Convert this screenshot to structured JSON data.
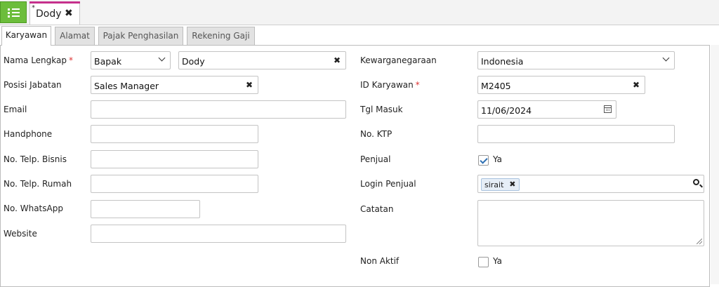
{
  "doc_tab": {
    "modified_marker": "*",
    "title": "Dody",
    "close": "✖"
  },
  "tabs": [
    {
      "label": "Karyawan"
    },
    {
      "label": "Alamat"
    },
    {
      "label": "Pajak Penghasilan"
    },
    {
      "label": "Rekening Gaji"
    }
  ],
  "required_marker": "*",
  "clear_glyph": "✖",
  "form_left": {
    "nama_lengkap": {
      "label": "Nama Lengkap",
      "title_value": "Bapak",
      "name_value": "Dody"
    },
    "posisi_jabatan": {
      "label": "Posisi Jabatan",
      "value": "Sales Manager"
    },
    "email": {
      "label": "Email",
      "value": ""
    },
    "handphone": {
      "label": "Handphone",
      "value": ""
    },
    "telp_bisnis": {
      "label": "No. Telp. Bisnis",
      "value": ""
    },
    "telp_rumah": {
      "label": "No. Telp. Rumah",
      "value": ""
    },
    "whatsapp": {
      "label": "No. WhatsApp",
      "value": ""
    },
    "website": {
      "label": "Website",
      "value": ""
    }
  },
  "form_right": {
    "kewarganegaraan": {
      "label": "Kewarganegaraan",
      "value": "Indonesia"
    },
    "id_karyawan": {
      "label": "ID Karyawan",
      "value": "M2405"
    },
    "tgl_masuk": {
      "label": "Tgl Masuk",
      "value": "11/06/2024"
    },
    "no_ktp": {
      "label": "No. KTP",
      "value": ""
    },
    "penjual": {
      "label": "Penjual",
      "checked": true,
      "option": "Ya"
    },
    "login_penjual": {
      "label": "Login Penjual",
      "tags": [
        "sirait"
      ]
    },
    "catatan": {
      "label": "Catatan",
      "value": ""
    },
    "non_aktif": {
      "label": "Non Aktif",
      "checked": false,
      "option": "Ya"
    }
  },
  "colors": {
    "menu_green": "#6cbd3b",
    "tab_highlight": "#c5308c",
    "required_red": "#dd3333",
    "check_blue": "#2d6fb3"
  }
}
